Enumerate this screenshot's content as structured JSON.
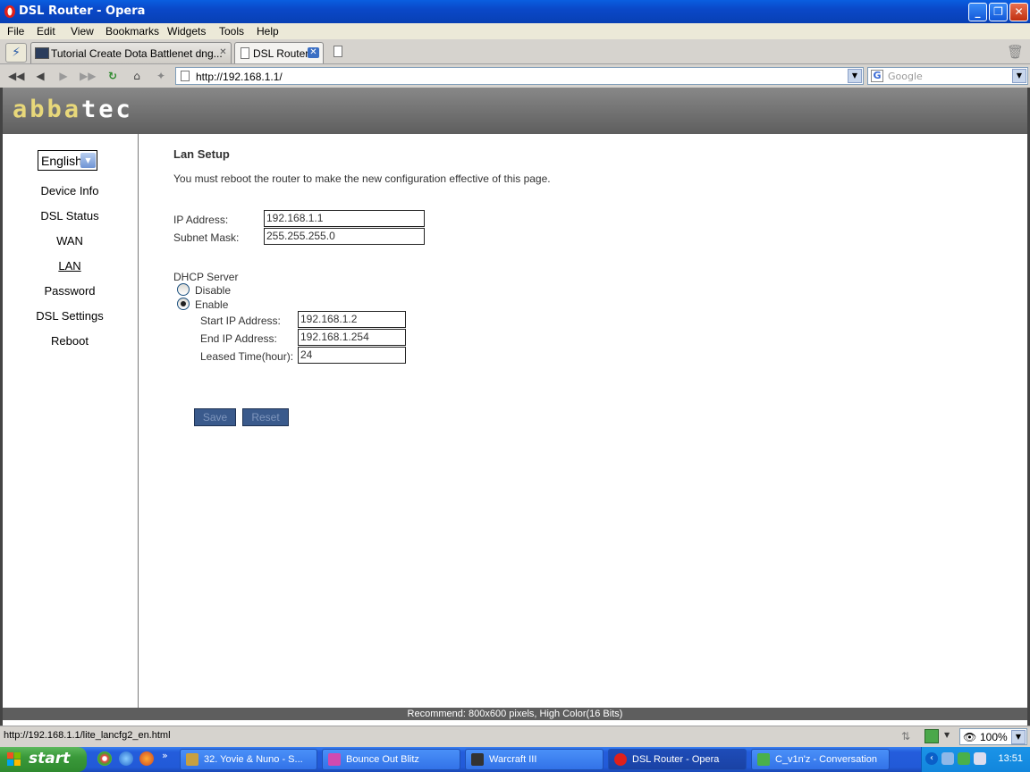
{
  "window": {
    "title": "DSL Router - Opera",
    "minimize": "_",
    "maximize": "❐",
    "close": "✕"
  },
  "menu": [
    "File",
    "Edit",
    "View",
    "Bookmarks",
    "Widgets",
    "Tools",
    "Help"
  ],
  "tabs": [
    {
      "label": "Tutorial Create Dota Battlenet dng...",
      "close": "✕",
      "active": false
    },
    {
      "label": "DSL Router",
      "close": "✕",
      "active": true
    }
  ],
  "address_bar": {
    "url": "http://192.168.1.1/",
    "search_placeholder": "Google"
  },
  "router_page": {
    "logo_part1": "abba",
    "logo_part2": "tec",
    "language": "English",
    "nav": [
      "Device Info",
      "DSL Status",
      "WAN",
      "LAN",
      "Password",
      "DSL Settings",
      "Reboot"
    ],
    "current_nav": "LAN",
    "heading": "Lan Setup",
    "notice": "You must reboot the router to make the new configuration effective of this page.",
    "ip_label": "IP Address:",
    "ip_value": "192.168.1.1",
    "mask_label": "Subnet Mask:",
    "mask_value": "255.255.255.0",
    "dhcp_label": "DHCP Server",
    "disable_label": "Disable",
    "enable_label": "Enable",
    "dhcp_selected": "Enable",
    "start_label": "Start IP Address:",
    "start_value": "192.168.1.2",
    "end_label": "End IP Address:",
    "end_value": "192.168.1.254",
    "lease_label": "Leased Time(hour):",
    "lease_value": "24",
    "save": "Save",
    "reset": "Reset",
    "footer": "Recommend: 800x600 pixels, High Color(16 Bits)"
  },
  "status_bar": {
    "link_url": "http://192.168.1.1/lite_lancfg2_en.html",
    "zoom": "100%"
  },
  "taskbar": {
    "start": "start",
    "tasks": [
      {
        "label": "32. Yovie & Nuno - S...",
        "active": false
      },
      {
        "label": "Bounce Out Blitz",
        "active": false
      },
      {
        "label": "Warcraft III",
        "active": false
      },
      {
        "label": "DSL Router - Opera",
        "active": true
      },
      {
        "label": "C_v1n'z - Conversation",
        "active": false
      }
    ],
    "clock": "13:51"
  }
}
